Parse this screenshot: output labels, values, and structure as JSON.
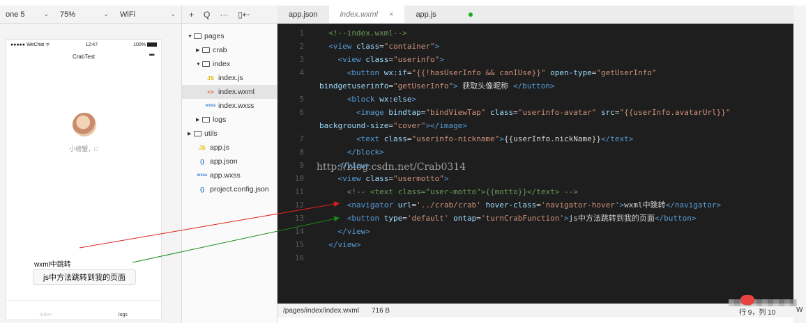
{
  "simulator_toolbar": {
    "device": "one 5",
    "zoom": "75%",
    "network": "WiFi"
  },
  "phone": {
    "status_left": "●●●●● WeChat ᯤ",
    "status_time": "12:47",
    "status_right": "100%",
    "nav_title": "CrabTest",
    "nav_dots": "•••",
    "nickname": "小螃蟹，□",
    "navigator_text": "wxml中跳转",
    "button_text": "js中方法跳转到我的页面",
    "tabs": [
      "index",
      "logs"
    ]
  },
  "tree_toolbar": [
    "+",
    "Q",
    "···",
    "▯⇠"
  ],
  "file_tree": [
    {
      "label": "pages",
      "type": "folder",
      "open": true,
      "depth": 0
    },
    {
      "label": "crab",
      "type": "folder",
      "open": false,
      "depth": 1
    },
    {
      "label": "index",
      "type": "folder",
      "open": true,
      "depth": 1
    },
    {
      "label": "index.js",
      "type": "js",
      "icon": "JS",
      "depth": 2
    },
    {
      "label": "index.wxml",
      "type": "wxml",
      "icon": "<>",
      "depth": 2,
      "selected": true
    },
    {
      "label": "index.wxss",
      "type": "wxss",
      "icon": "wxss",
      "depth": 2
    },
    {
      "label": "logs",
      "type": "folder",
      "open": false,
      "depth": 1
    },
    {
      "label": "utils",
      "type": "folder",
      "open": false,
      "depth": 0
    },
    {
      "label": "app.js",
      "type": "js",
      "icon": "JS",
      "depth": 1
    },
    {
      "label": "app.json",
      "type": "json",
      "icon": "{}",
      "depth": 1
    },
    {
      "label": "app.wxss",
      "type": "wxss",
      "icon": "wxss",
      "depth": 1
    },
    {
      "label": "project.config.json",
      "type": "json",
      "icon": "{}",
      "depth": 1
    }
  ],
  "editor_tabs": [
    {
      "label": "app.json",
      "active": false
    },
    {
      "label": "index.wxml",
      "active": true,
      "close": "×"
    },
    {
      "label": "app.js",
      "active": false
    }
  ],
  "code_lines": [
    {
      "n": "1",
      "tokens": [
        [
          "c",
          "  <!--index.wxml-->"
        ]
      ]
    },
    {
      "n": "2",
      "tokens": [
        [
          "t",
          "  <view "
        ],
        [
          "a",
          "class"
        ],
        [
          "x",
          "="
        ],
        [
          "s",
          "\"container\""
        ],
        [
          "t",
          ">"
        ]
      ]
    },
    {
      "n": "3",
      "tokens": [
        [
          "t",
          "    <view "
        ],
        [
          "a",
          "class"
        ],
        [
          "x",
          "="
        ],
        [
          "s",
          "\"userinfo\""
        ],
        [
          "t",
          ">"
        ]
      ]
    },
    {
      "n": "4",
      "tokens": [
        [
          "t",
          "      <button "
        ],
        [
          "a",
          "wx:if"
        ],
        [
          "x",
          "="
        ],
        [
          "s",
          "\"{{!hasUserInfo && canIUse}}\""
        ],
        [
          "x",
          " "
        ],
        [
          "a",
          "open-type"
        ],
        [
          "x",
          "="
        ],
        [
          "s",
          "\"getUserInfo\""
        ]
      ]
    },
    {
      "n": "",
      "tokens": [
        [
          "a",
          "bindgetuserinfo"
        ],
        [
          "x",
          "="
        ],
        [
          "s",
          "\"getUserInfo\""
        ],
        [
          "t",
          ">"
        ],
        [
          "x",
          " 获取头像昵称 "
        ],
        [
          "t",
          "</button>"
        ]
      ]
    },
    {
      "n": "5",
      "tokens": [
        [
          "t",
          "      <block "
        ],
        [
          "a",
          "wx:else"
        ],
        [
          "t",
          ">"
        ]
      ]
    },
    {
      "n": "6",
      "tokens": [
        [
          "t",
          "        <image "
        ],
        [
          "a",
          "bindtap"
        ],
        [
          "x",
          "="
        ],
        [
          "s",
          "\"bindViewTap\""
        ],
        [
          "x",
          " "
        ],
        [
          "a",
          "class"
        ],
        [
          "x",
          "="
        ],
        [
          "s",
          "\"userinfo-avatar\""
        ],
        [
          "x",
          " "
        ],
        [
          "a",
          "src"
        ],
        [
          "x",
          "="
        ],
        [
          "s",
          "\"{{userInfo.avatarUrl}}\""
        ]
      ]
    },
    {
      "n": "",
      "tokens": [
        [
          "a",
          "background-size"
        ],
        [
          "x",
          "="
        ],
        [
          "s",
          "\"cover\""
        ],
        [
          "t",
          "></image>"
        ]
      ]
    },
    {
      "n": "7",
      "tokens": [
        [
          "t",
          "        <text "
        ],
        [
          "a",
          "class"
        ],
        [
          "x",
          "="
        ],
        [
          "s",
          "\"userinfo-nickname\""
        ],
        [
          "t",
          ">"
        ],
        [
          "x",
          "{{userInfo.nickName}}"
        ],
        [
          "t",
          "</text>"
        ]
      ]
    },
    {
      "n": "8",
      "tokens": [
        [
          "t",
          "      </block>"
        ]
      ]
    },
    {
      "n": "9",
      "tokens": [
        [
          "t",
          "    </view>"
        ]
      ]
    },
    {
      "n": "10",
      "tokens": [
        [
          "t",
          "    <view "
        ],
        [
          "a",
          "class"
        ],
        [
          "x",
          "="
        ],
        [
          "s",
          "\"usermotto\""
        ],
        [
          "t",
          ">"
        ]
      ]
    },
    {
      "n": "11",
      "tokens": [
        [
          "c",
          "      <!-- <text class=\"user-motto\">{{motto}}</text> -->"
        ]
      ]
    },
    {
      "n": "12",
      "tokens": [
        [
          "t",
          "      <navigator "
        ],
        [
          "a",
          "url"
        ],
        [
          "x",
          "="
        ],
        [
          "s",
          "'../crab/crab'"
        ],
        [
          "x",
          " "
        ],
        [
          "a",
          "hover-class"
        ],
        [
          "x",
          "="
        ],
        [
          "s",
          "'navigator-hover'"
        ],
        [
          "t",
          ">"
        ],
        [
          "x",
          "wxml中跳转"
        ],
        [
          "t",
          "</navigator>"
        ]
      ]
    },
    {
      "n": "13",
      "tokens": [
        [
          "t",
          "      <button "
        ],
        [
          "a",
          "type"
        ],
        [
          "x",
          "="
        ],
        [
          "s",
          "'default'"
        ],
        [
          "x",
          " "
        ],
        [
          "a",
          "ontap"
        ],
        [
          "x",
          "="
        ],
        [
          "s",
          "'turnCrabFunction'"
        ],
        [
          "t",
          ">"
        ],
        [
          "x",
          "js中方法跳转到我的页面"
        ],
        [
          "t",
          "</button>"
        ]
      ]
    },
    {
      "n": "14",
      "tokens": [
        [
          "t",
          "    </view>"
        ]
      ]
    },
    {
      "n": "15",
      "tokens": [
        [
          "t",
          "  </view>"
        ]
      ]
    },
    {
      "n": "16",
      "tokens": []
    }
  ],
  "watermark": "http://blog.csdn.net/Crab0314",
  "status_bar": {
    "path": "/pages/index/index.wxml",
    "size": "716 B",
    "cursor": "行 9，列 10",
    "right": "W"
  },
  "colors": {
    "arrow_red": "#e0201b",
    "arrow_green": "#1a8a1a",
    "editor_bg": "#1e1e1e"
  }
}
